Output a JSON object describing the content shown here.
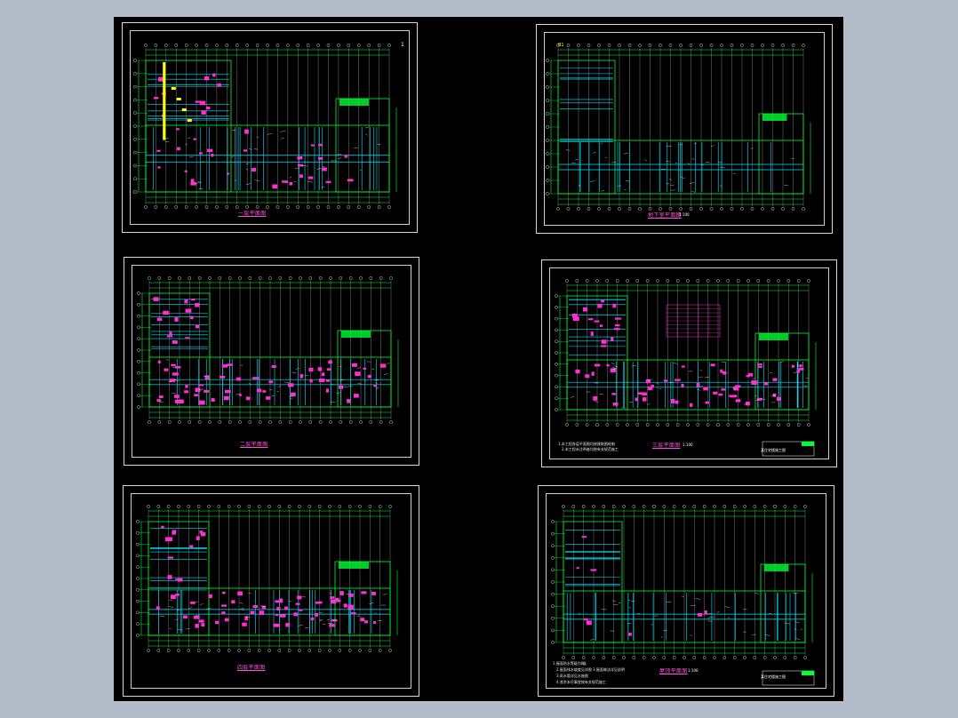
{
  "viewer": {
    "background": "#b3bcc9",
    "canvas": "#000000"
  },
  "sheets": [
    {
      "id": "s1",
      "caption": "一层平面图",
      "scale": "",
      "marker": "1"
    },
    {
      "id": "s2",
      "caption": "地下室平面图",
      "scale": "1:100",
      "label": "B1"
    },
    {
      "id": "s3",
      "caption": "二层平面图",
      "scale": ""
    },
    {
      "id": "s4",
      "caption": "三层平面图",
      "scale": "1:100",
      "notes": [
        "1.本工程各层平面图均按建筑图绘制",
        "2.本工程未注明者均按有关规范施工"
      ],
      "title_block": "某住宅楼施工图"
    },
    {
      "id": "s5",
      "caption": "四层平面图",
      "scale": ""
    },
    {
      "id": "s6",
      "caption": "屋顶平面图",
      "scale": "1:100",
      "notes": [
        "1.屋面防水等级为Ⅱ级",
        "2.屋面排水坡度见详图 3.屋面做法详见说明",
        "3.雨水管详见水施图",
        "4.其余未尽事宜按有关规范施工"
      ],
      "title_block": "某住宅楼施工图"
    }
  ],
  "colors": {
    "green": "#00ff33",
    "cyan": "#00e5ff",
    "magenta": "#ff2fd4",
    "yellow": "#ffff00",
    "white": "#ffffff",
    "red": "#ff3030"
  }
}
